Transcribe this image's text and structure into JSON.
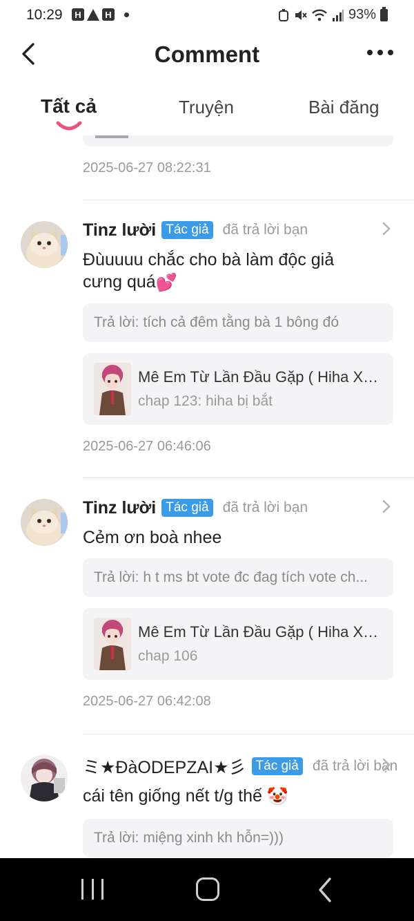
{
  "status_bar": {
    "time": "10:29",
    "notif_icons": [
      "H",
      "warning",
      "H"
    ],
    "battery": "93%"
  },
  "header": {
    "title": "Comment"
  },
  "tabs": [
    {
      "label": "Tất cả",
      "active": true
    },
    {
      "label": "Truyện",
      "active": false
    },
    {
      "label": "Bài đăng",
      "active": false
    }
  ],
  "colors": {
    "accent": "#e8557a",
    "badge": "#3b9be6"
  },
  "feed": {
    "top_timestamp": "2025-06-27 08:22:31",
    "comments": [
      {
        "user": "Tinz lười",
        "badge": "Tác giả",
        "action": "đã trả lời bạn",
        "text": "Đùuuuu chắc cho bà làm độc giả cưng quá",
        "emoji": "💕",
        "reply": "Trả lời: tích cả đêm tằng bà 1 bông đó",
        "story_title": "Mê Em Từ Lần Đầu Gặp ( Hiha X ...",
        "story_chapter": "chap 123: hiha bị bắt",
        "timestamp": "2025-06-27 06:46:06"
      },
      {
        "user": "Tinz lười",
        "badge": "Tác giả",
        "action": "đã trả lời bạn",
        "text": "Cẻm ơn boà nhee",
        "reply": "Trả lời: h t ms bt vote đc đag tích vote ch...",
        "story_title": "Mê Em Từ Lần Đầu Gặp ( Hiha X ...",
        "story_chapter": "chap 106",
        "timestamp": "2025-06-27 06:42:08"
      },
      {
        "user": "ミ★ĐàODEPZAI★彡",
        "badge": "Tác giả",
        "action": "đã trả lời bạn",
        "text": "cái tên giống nết t/g thế",
        "emoji": "🤡",
        "reply": "Trả lời: miệng xinh kh hỗn=)))"
      }
    ]
  }
}
